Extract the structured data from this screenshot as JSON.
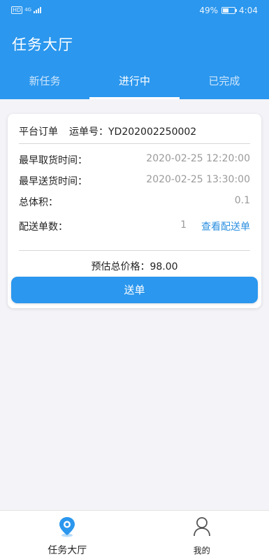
{
  "status_bar": {
    "hd": "HD",
    "network": "4G",
    "battery_percent": "49%",
    "battery_level": 0.49,
    "time": "4:04"
  },
  "header": {
    "title": "任务大厅"
  },
  "tabs": [
    {
      "label": "新任务",
      "active": false
    },
    {
      "label": "进行中",
      "active": true
    },
    {
      "label": "已完成",
      "active": false
    }
  ],
  "order": {
    "platform_label": "平台订单",
    "waybill_label": "运单号：",
    "waybill_no": "YD202002250002",
    "pickup_label": "最早取货时间：",
    "pickup_time": "2020-02-25 12:20:00",
    "delivery_label": "最早送货时间：",
    "delivery_time": "2020-02-25 13:30:00",
    "volume_label": "总体积：",
    "volume_value": "0.1",
    "count_label": "配送单数：",
    "count_value": "1",
    "view_link": "查看配送单",
    "price_label": "预估总价格：",
    "price_value": "98.00",
    "send_button": "送单"
  },
  "bottom_nav": [
    {
      "label": "任务大厅",
      "icon": "location-pin-icon",
      "active": true
    },
    {
      "label": "我的",
      "icon": "user-icon",
      "active": false
    }
  ],
  "colors": {
    "primary": "#2b97ee",
    "background": "#f4f3f8",
    "link": "#2b8fe0",
    "muted": "#9a9a9a"
  }
}
